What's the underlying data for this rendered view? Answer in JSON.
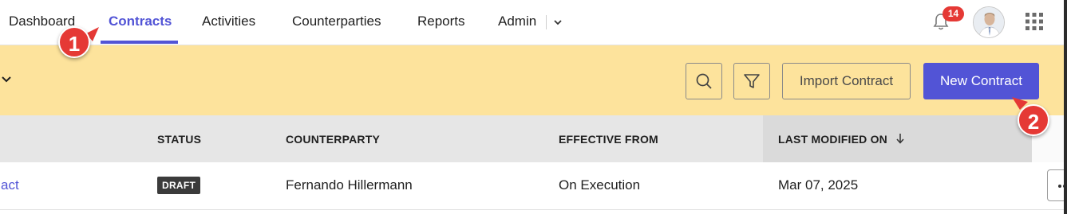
{
  "nav": {
    "items": [
      {
        "label": "Dashboard"
      },
      {
        "label": "Contracts"
      },
      {
        "label": "Activities"
      },
      {
        "label": "Counterparties"
      },
      {
        "label": "Reports"
      },
      {
        "label": "Admin"
      }
    ],
    "active": "Contracts",
    "notification_count": "14"
  },
  "toolbar": {
    "import_label": "Import Contract",
    "new_label": "New Contract"
  },
  "table": {
    "columns": [
      "STATUS",
      "COUNTERPARTY",
      "EFFECTIVE FROM",
      "LAST MODIFIED ON"
    ],
    "sorted_column": "LAST MODIFIED ON",
    "rows": [
      {
        "name": "act",
        "status": "DRAFT",
        "counterparty": "Fernando Hillermann",
        "effective_from": "On Execution",
        "last_modified": "Mar 07, 2025"
      }
    ]
  },
  "markers": [
    "1",
    "2"
  ],
  "colors": {
    "accent": "#5254d6",
    "toolbar_bg": "#fde39c",
    "marker": "#e53935"
  },
  "icons": [
    "chevron-down-icon",
    "search-icon",
    "filter-icon",
    "bell-icon",
    "apps-grid-icon",
    "sort-down-icon",
    "more-icon"
  ]
}
